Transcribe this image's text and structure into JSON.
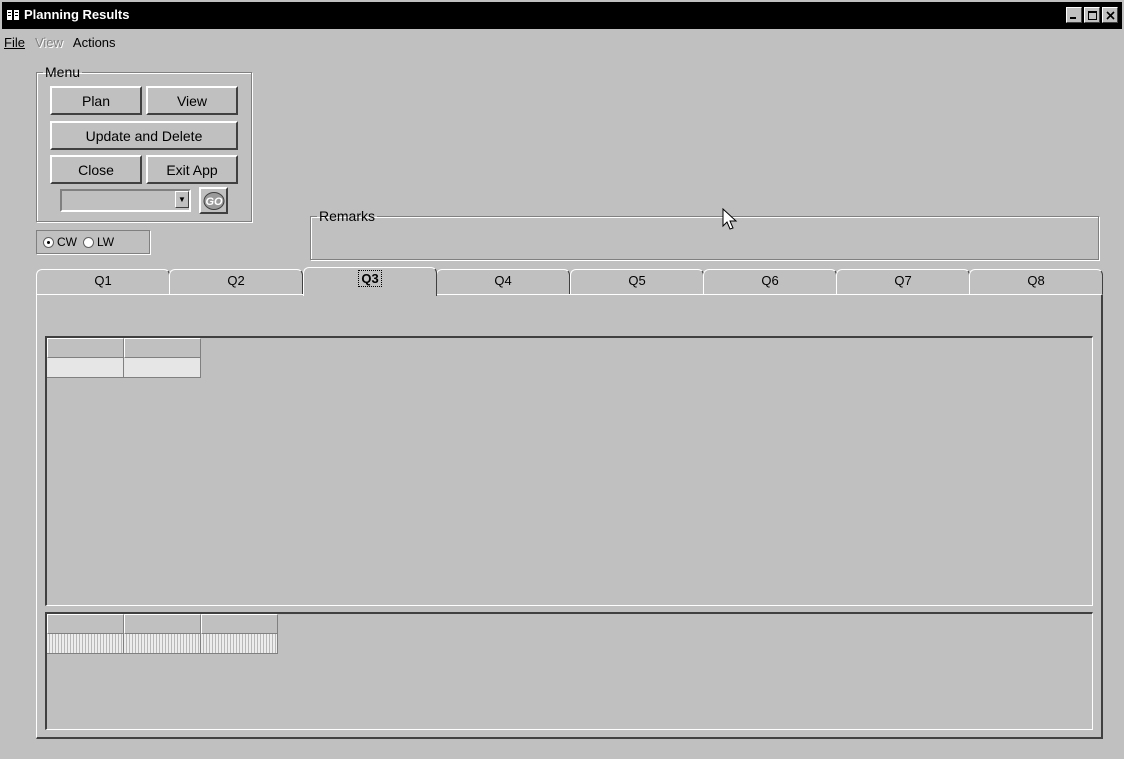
{
  "window": {
    "title": "Planning Results",
    "controls": [
      "minimize-icon",
      "maximize-icon",
      "close-icon"
    ]
  },
  "menubar": {
    "file": "File",
    "view": "View",
    "actions": "Actions"
  },
  "menu_group": {
    "legend": "Menu",
    "plan": "Plan",
    "view": "View",
    "update_delete": "Update and Delete",
    "close": "Close",
    "exit_app": "Exit App",
    "combo_value": "",
    "go_label": "GO"
  },
  "week_options": {
    "cw": "CW",
    "lw": "LW",
    "selected": "CW"
  },
  "remarks": {
    "legend": "Remarks",
    "text": ""
  },
  "tabs": [
    "Q1",
    "Q2",
    "Q3",
    "Q4",
    "Q5",
    "Q6",
    "Q7",
    "Q8"
  ],
  "active_tab": "Q3"
}
